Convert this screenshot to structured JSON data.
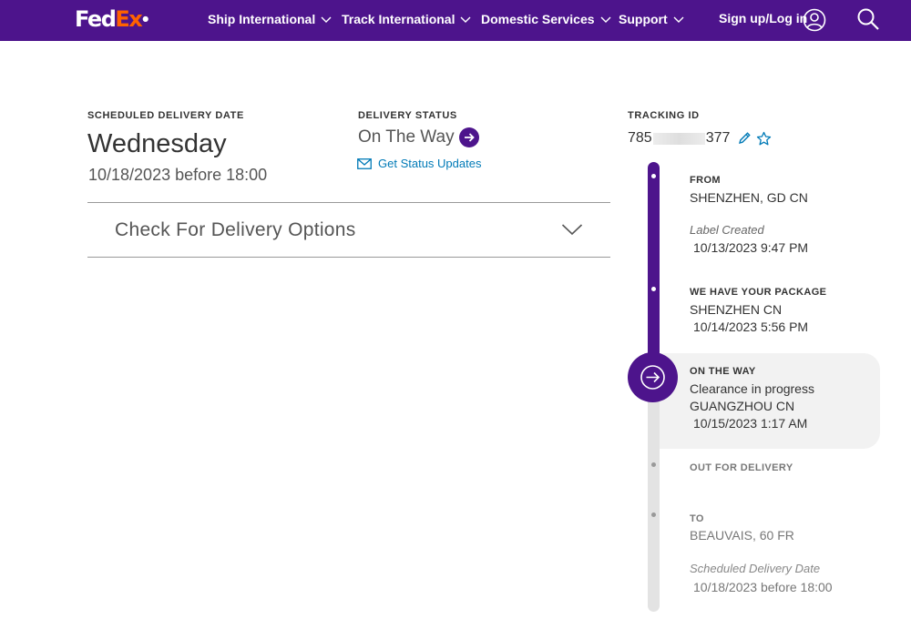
{
  "header": {
    "logo_fed": "Fed",
    "logo_ex": "Ex",
    "nav": [
      {
        "label": "Ship International"
      },
      {
        "label": "Track International"
      },
      {
        "label": "Domestic Services"
      },
      {
        "label": "Support"
      }
    ],
    "signin_label": "Sign up/Log in"
  },
  "summary": {
    "scheduled_label": "SCHEDULED DELIVERY DATE",
    "scheduled_day": "Wednesday",
    "scheduled_datetime": "10/18/2023 before 18:00",
    "status_label": "DELIVERY STATUS",
    "status_value": "On The Way",
    "status_updates_link": "Get Status Updates",
    "tracking_label": "TRACKING ID",
    "tracking_prefix": "785",
    "tracking_suffix": "377"
  },
  "delivery_options": {
    "label": "Check For Delivery Options"
  },
  "timeline": {
    "from": {
      "heading": "FROM",
      "location": "SHENZHEN, GD CN",
      "note": "Label Created",
      "time": "10/13/2023 9:47 PM"
    },
    "picked_up": {
      "heading": "WE HAVE YOUR PACKAGE",
      "location": "SHENZHEN CN",
      "time": "10/14/2023 5:56 PM"
    },
    "on_the_way": {
      "heading": "ON THE WAY",
      "detail": "Clearance in progress",
      "location": "GUANGZHOU CN",
      "time": "10/15/2023 1:17 AM"
    },
    "out_for_delivery": {
      "heading": "OUT FOR DELIVERY"
    },
    "to": {
      "heading": "TO",
      "location": "BEAUVAIS, 60 FR",
      "note": "Scheduled Delivery Date",
      "time": "10/18/2023 before 18:00"
    }
  },
  "colors": {
    "brand_purple": "#4d148c",
    "brand_orange": "#ff6200",
    "link_blue": "#007ab7"
  }
}
